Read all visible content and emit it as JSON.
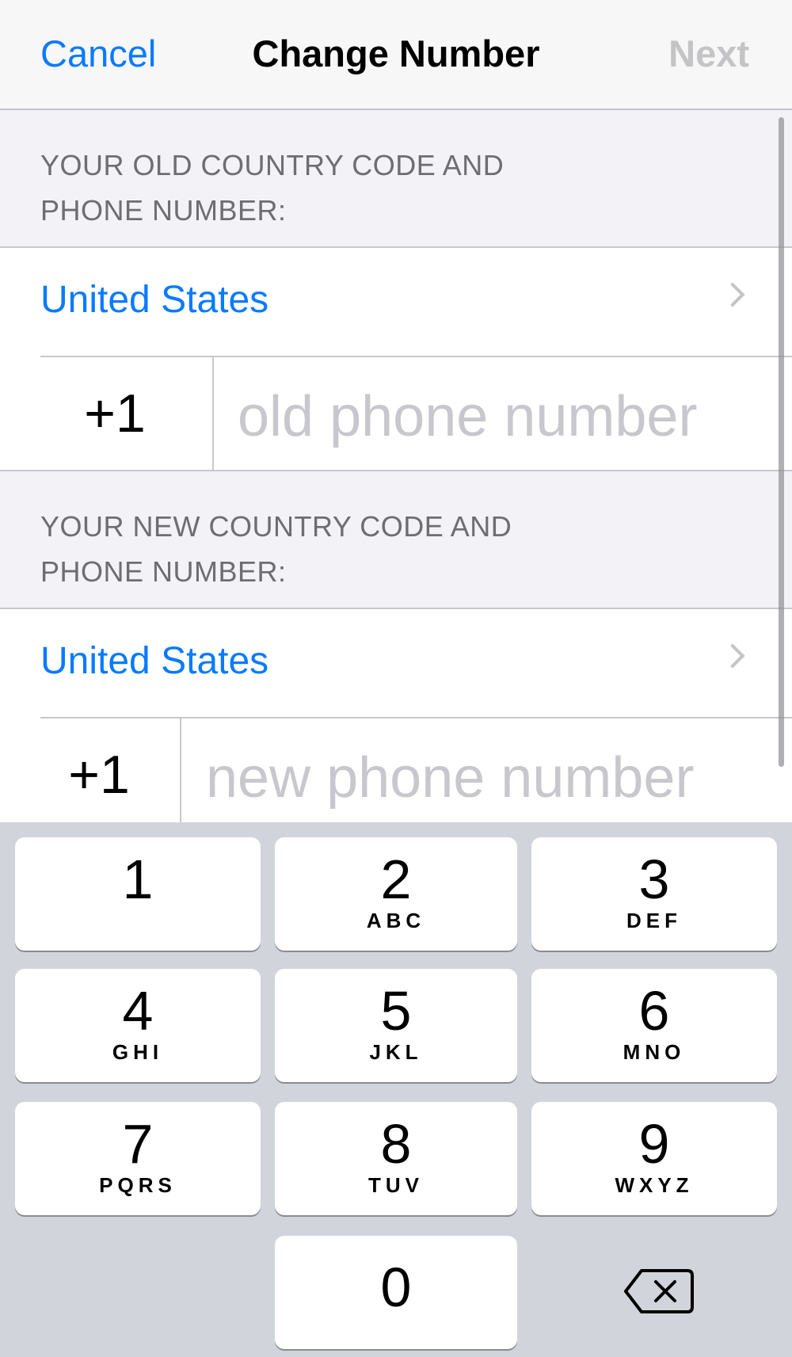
{
  "navbar": {
    "cancel_label": "Cancel",
    "title": "Change Number",
    "next_label": "Next"
  },
  "old_section": {
    "header_line1": "YOUR OLD COUNTRY CODE AND",
    "header_line2": "PHONE NUMBER:",
    "country": "United States",
    "country_code": "+1",
    "phone_value": "",
    "phone_placeholder": "old phone number"
  },
  "new_section": {
    "header_line1": "YOUR NEW COUNTRY CODE AND",
    "header_line2": "PHONE NUMBER:",
    "country": "United States",
    "country_code": "+1",
    "phone_value": "",
    "phone_placeholder": "new phone number"
  },
  "keypad": {
    "keys": [
      {
        "digit": "1",
        "letters": ""
      },
      {
        "digit": "2",
        "letters": "ABC"
      },
      {
        "digit": "3",
        "letters": "DEF"
      },
      {
        "digit": "4",
        "letters": "GHI"
      },
      {
        "digit": "5",
        "letters": "JKL"
      },
      {
        "digit": "6",
        "letters": "MNO"
      },
      {
        "digit": "7",
        "letters": "PQRS"
      },
      {
        "digit": "8",
        "letters": "TUV"
      },
      {
        "digit": "9",
        "letters": "WXYZ"
      },
      {
        "digit": "0",
        "letters": ""
      }
    ],
    "delete_icon": "backspace-icon"
  },
  "colors": {
    "accent": "#0a7aff",
    "disabled": "#c4c4c6",
    "section_text": "#6d6d72",
    "keyboard_bg": "#d1d5db"
  }
}
